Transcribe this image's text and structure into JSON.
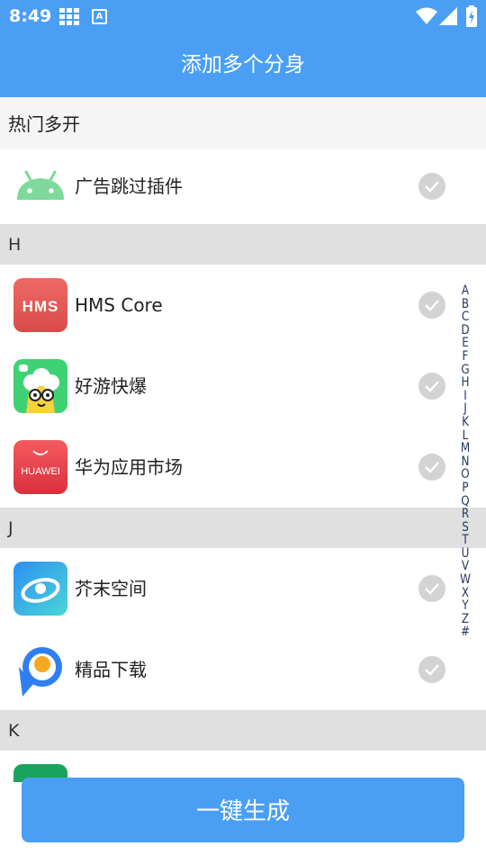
{
  "status_bar": {
    "time": "8:49",
    "a_badge": "A"
  },
  "title": "添加多个分身",
  "hot_section": {
    "header": "热门多开",
    "items": [
      {
        "name": "广告跳过插件",
        "icon": "android-icon"
      }
    ]
  },
  "sections": [
    {
      "letter": "H",
      "items": [
        {
          "name": "HMS Core",
          "icon": "hms-core-icon",
          "icon_text": "HMS"
        },
        {
          "name": "好游快爆",
          "icon": "haoyoukuaibao-icon"
        },
        {
          "name": "华为应用市场",
          "icon": "huawei-appgallery-icon",
          "icon_text": "HUAWEI"
        }
      ]
    },
    {
      "letter": "J",
      "items": [
        {
          "name": "芥末空间",
          "icon": "jiemo-space-icon"
        },
        {
          "name": "精品下载",
          "icon": "jingpin-download-icon"
        }
      ]
    },
    {
      "letter": "K",
      "items": []
    }
  ],
  "index_letters": [
    "A",
    "B",
    "C",
    "D",
    "E",
    "F",
    "G",
    "H",
    "I",
    "J",
    "K",
    "L",
    "M",
    "N",
    "O",
    "P",
    "Q",
    "R",
    "S",
    "T",
    "U",
    "V",
    "W",
    "X",
    "Y",
    "Z",
    "#"
  ],
  "generate_button": "一键生成",
  "colors": {
    "primary": "#4a9ff5",
    "section_bg": "#e0e0e0",
    "check_gray": "#d3d3d3",
    "index_text": "#24395e"
  }
}
